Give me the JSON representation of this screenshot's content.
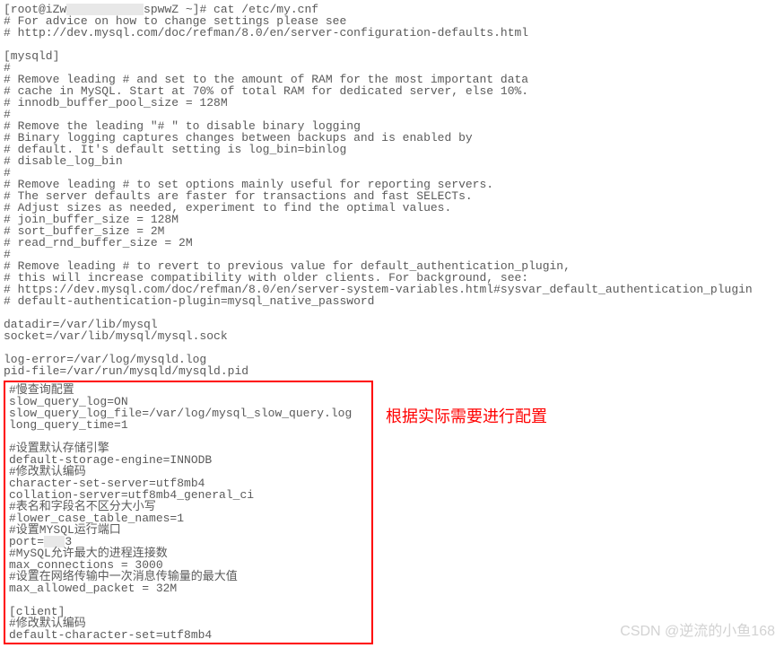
{
  "terminal": {
    "prompt_prefix": "[root@iZw",
    "prompt_censored": "           ",
    "prompt_suffix": "spwwZ ~]# cat /etc/my.cnf",
    "lines_top": [
      "# For advice on how to change settings please see",
      "# http://dev.mysql.com/doc/refman/8.0/en/server-configuration-defaults.html",
      "",
      "[mysqld]",
      "#",
      "# Remove leading # and set to the amount of RAM for the most important data",
      "# cache in MySQL. Start at 70% of total RAM for dedicated server, else 10%.",
      "# innodb_buffer_pool_size = 128M",
      "#",
      "# Remove the leading \"# \" to disable binary logging",
      "# Binary logging captures changes between backups and is enabled by",
      "# default. It's default setting is log_bin=binlog",
      "# disable_log_bin",
      "#",
      "# Remove leading # to set options mainly useful for reporting servers.",
      "# The server defaults are faster for transactions and fast SELECTs.",
      "# Adjust sizes as needed, experiment to find the optimal values.",
      "# join_buffer_size = 128M",
      "# sort_buffer_size = 2M",
      "# read_rnd_buffer_size = 2M",
      "#",
      "# Remove leading # to revert to previous value for default_authentication_plugin,",
      "# this will increase compatibility with older clients. For background, see:",
      "# https://dev.mysql.com/doc/refman/8.0/en/server-system-variables.html#sysvar_default_authentication_plugin",
      "# default-authentication-plugin=mysql_native_password",
      "",
      "datadir=/var/lib/mysql",
      "socket=/var/lib/mysql/mysql.sock",
      "",
      "log-error=/var/log/mysqld.log",
      "pid-file=/var/run/mysqld/mysqld.pid"
    ],
    "boxed_lines_pre": [
      "#慢查询配置",
      "slow_query_log=ON",
      "slow_query_log_file=/var/log/mysql_slow_query.log",
      "long_query_time=1",
      "",
      "#设置默认存储引擎",
      "default-storage-engine=INNODB",
      "#修改默认编码",
      "character-set-server=utf8mb4",
      "collation-server=utf8mb4_general_ci",
      "#表名和字段名不区分大小写",
      "#lower_case_table_names=1",
      "#设置MYSQL运行端口"
    ],
    "port_prefix": "port=",
    "port_censored": "   ",
    "port_suffix": "3",
    "boxed_lines_post": [
      "#MySQL允许最大的进程连接数",
      "max_connections = 3000",
      "#设置在网络传输中一次消息传输量的最大值",
      "max_allowed_packet = 32M",
      "",
      "[client]",
      "#修改默认编码",
      "default-character-set=utf8mb4"
    ]
  },
  "annotation": {
    "text": "根据实际需要进行配置"
  },
  "watermark": {
    "text": "CSDN @逆流的小鱼168"
  }
}
